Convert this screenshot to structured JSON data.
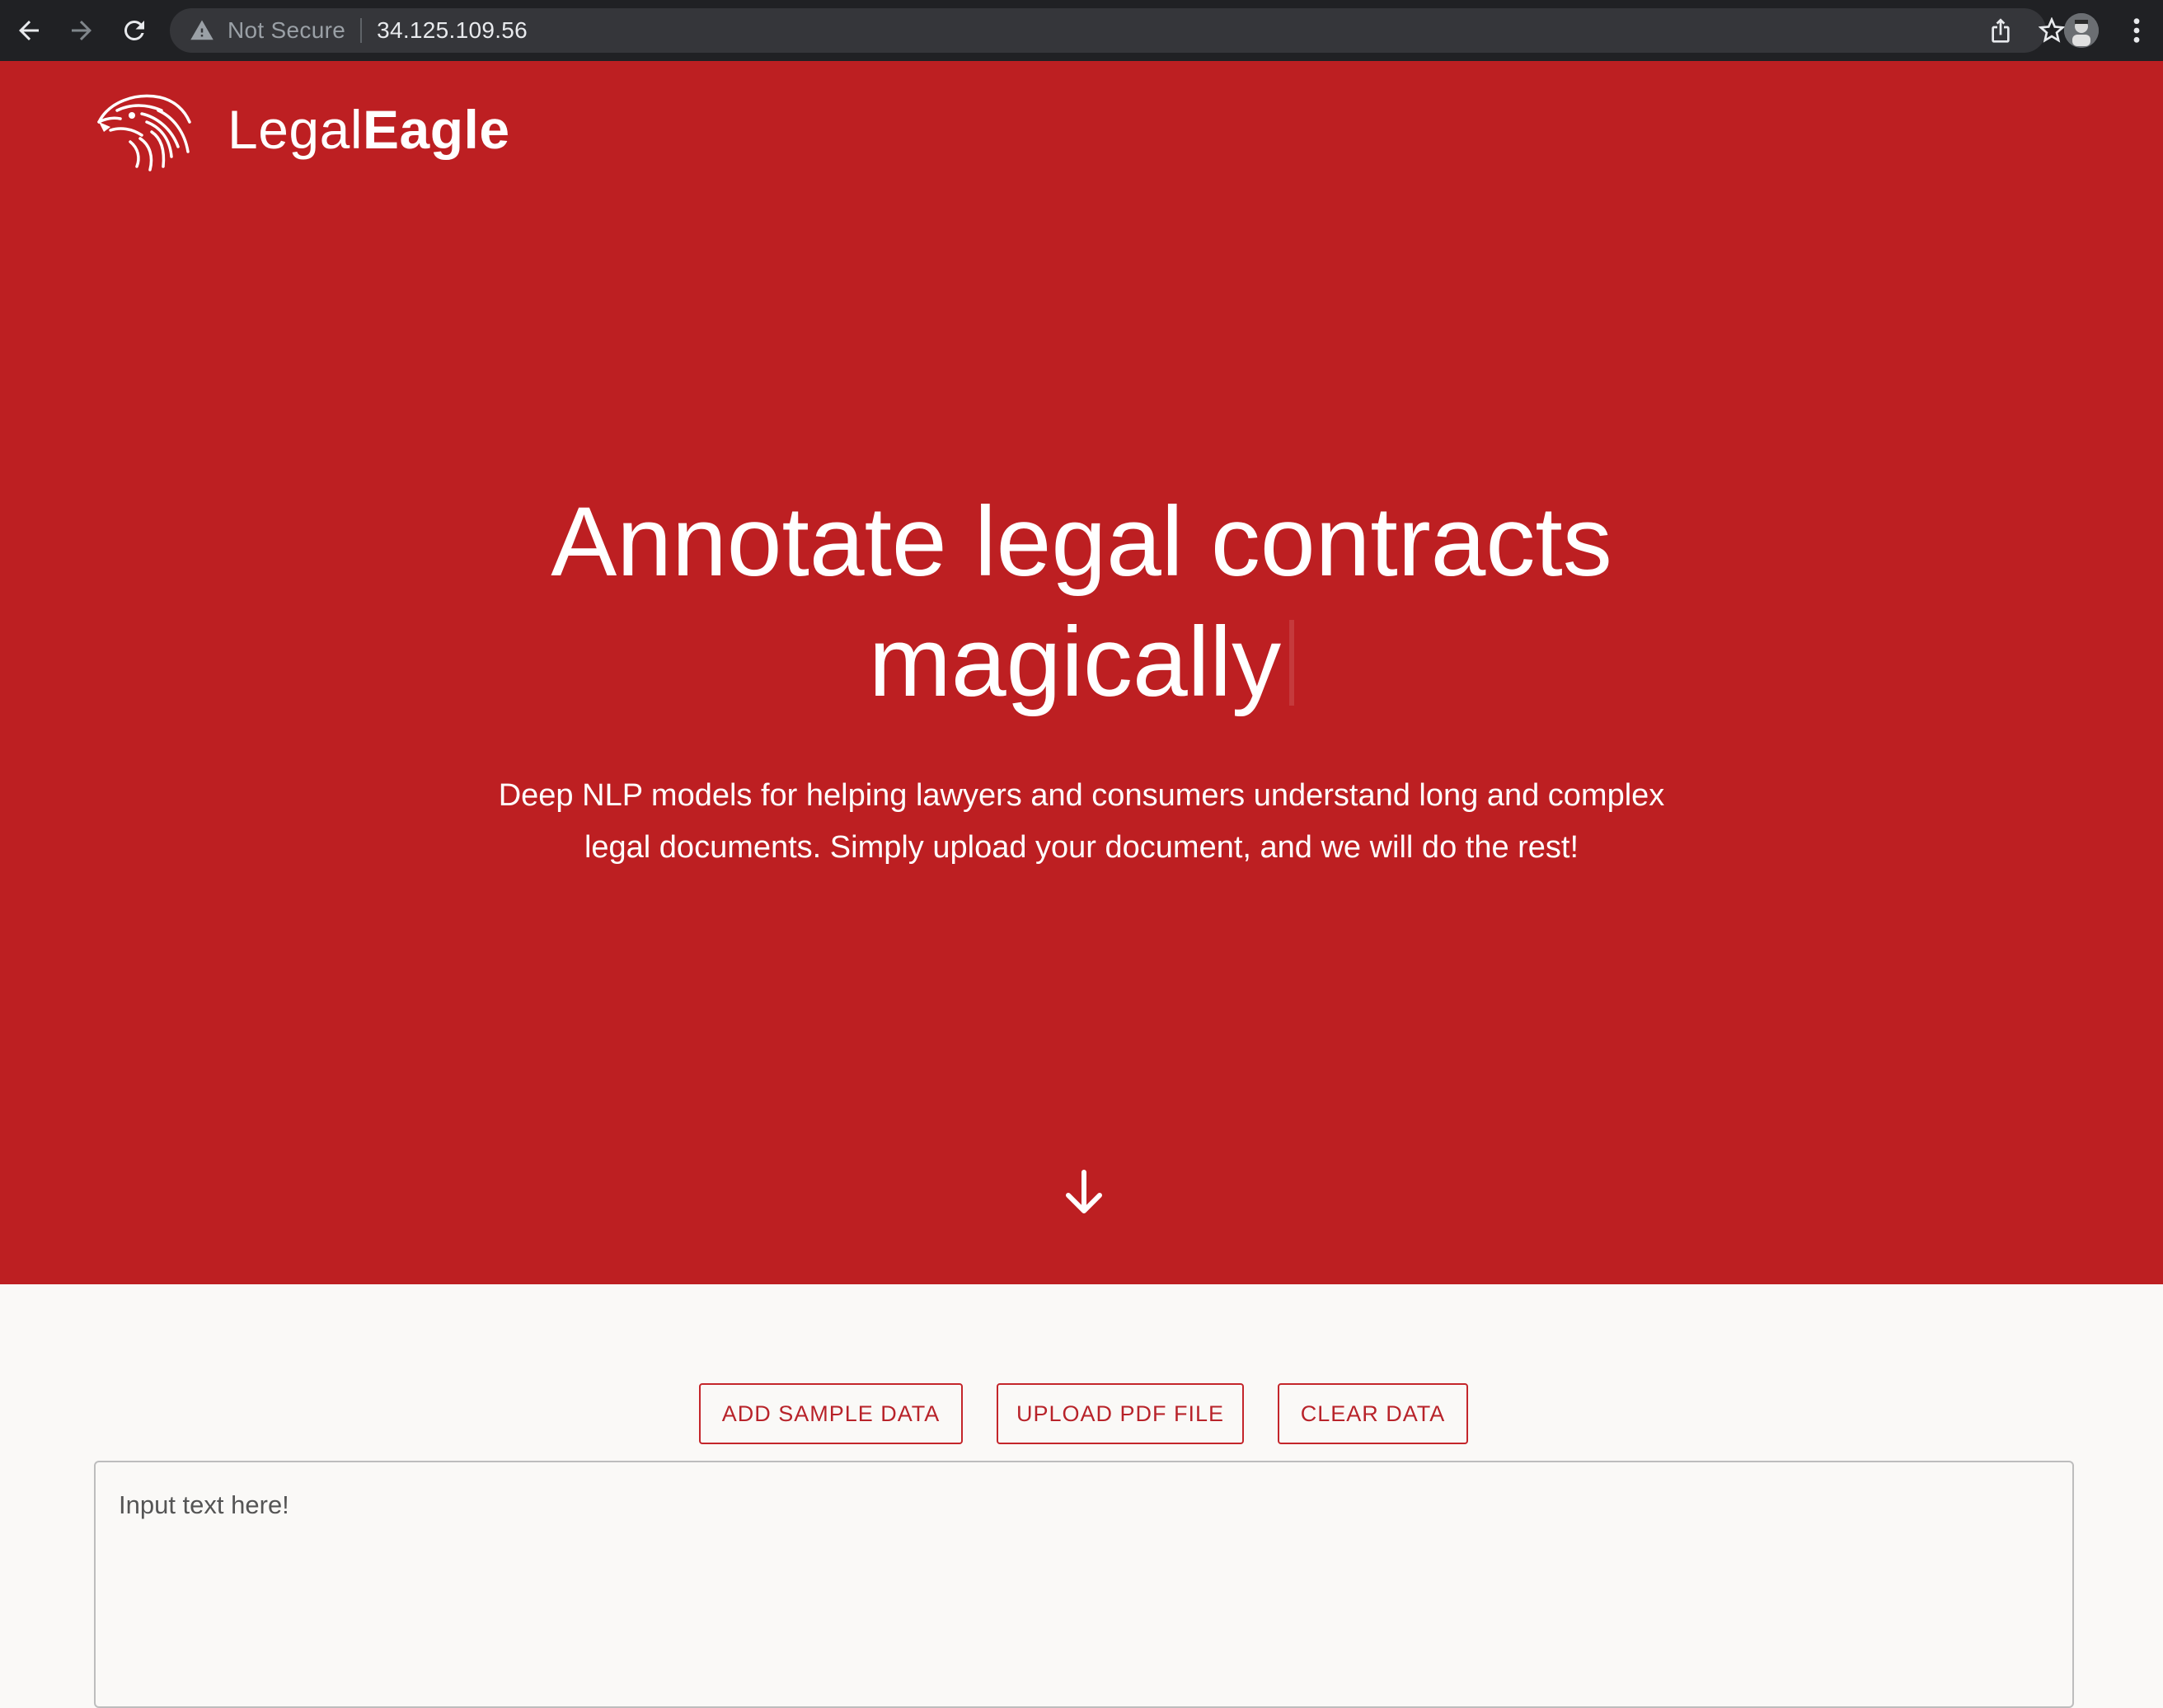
{
  "browser": {
    "security_label": "Not Secure",
    "url": "34.125.109.56",
    "icons": [
      "back-icon",
      "forward-icon",
      "reload-icon",
      "warning-icon",
      "share-icon",
      "star-icon",
      "avatar",
      "kebab-menu-icon"
    ]
  },
  "brand": {
    "name_regular": "Legal",
    "name_bold": "Eagle",
    "logo_icon": "eagle-head-icon"
  },
  "hero": {
    "title_line1": "Annotate legal contracts",
    "title_line2": "magically",
    "subtitle_line1": "Deep NLP models for helping lawyers and consumers understand long and complex",
    "subtitle_line2": "legal documents. Simply upload your document, and we will do the rest!",
    "scroll_icon": "arrow-down-icon",
    "background_color": "#bd1f22"
  },
  "actions": {
    "add_sample": "ADD SAMPLE DATA",
    "upload_pdf": "UPLOAD PDF FILE",
    "clear": "CLEAR DATA",
    "accent_color": "#c4262b"
  },
  "editor": {
    "placeholder": "Input text here!",
    "value": ""
  }
}
